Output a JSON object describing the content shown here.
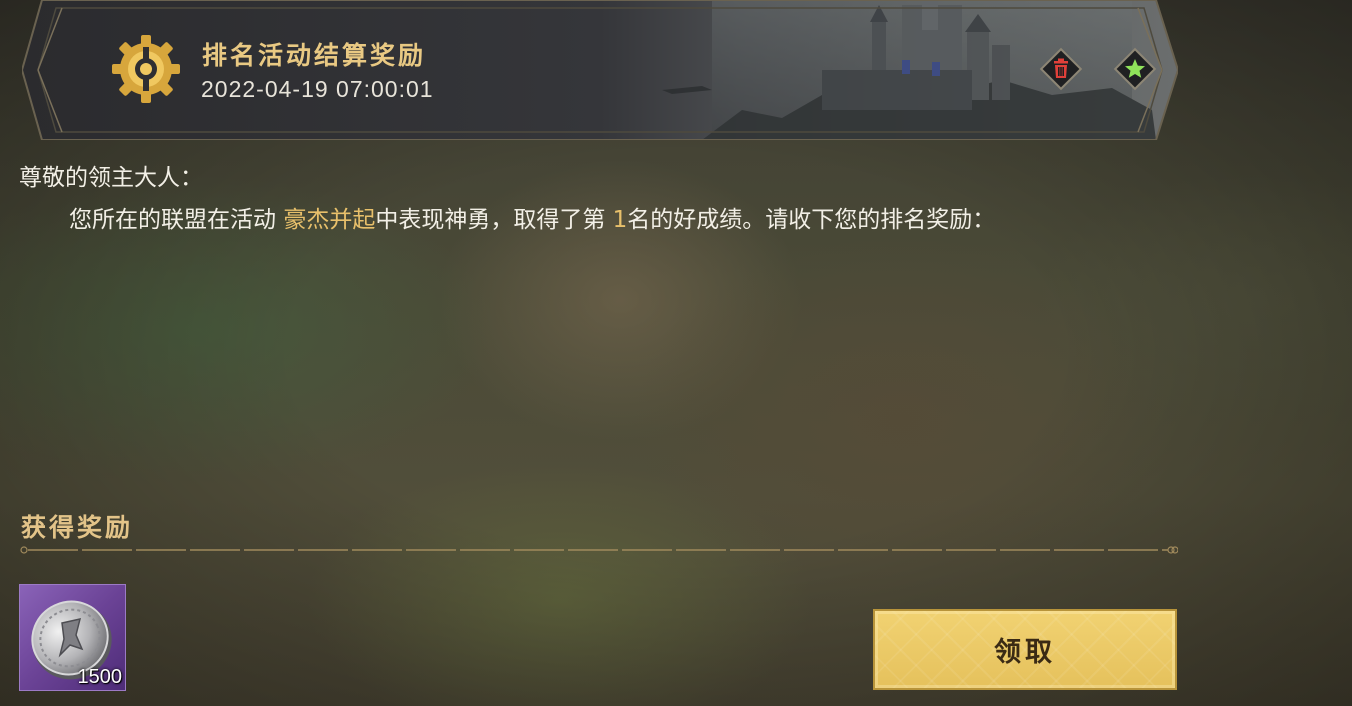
{
  "header": {
    "title": "排名活动结算奖励",
    "timestamp": "2022-04-19 07:00:01",
    "icon": "gear-icon",
    "actions": [
      {
        "name": "delete",
        "icon": "trash-icon",
        "color": "#e0403a"
      },
      {
        "name": "favorite",
        "icon": "star-icon",
        "color": "#8fe35a"
      }
    ]
  },
  "message": {
    "greeting": "尊敬的领主大人：",
    "part1": "您所在的联盟在活动 ",
    "event_name": "豪杰并起",
    "part2": "中表现神勇，取得了第 ",
    "rank": "1",
    "part3": "名的好成绩。请收下您的排名奖励："
  },
  "rewards": {
    "title": "获得奖励",
    "items": [
      {
        "icon": "silver-coin-icon",
        "count": "1500"
      }
    ]
  },
  "claim_button": {
    "label": "领取"
  },
  "colors": {
    "accent_gold": "#e8c06b",
    "button_gold": "#e5c15c",
    "item_purple": "#6b4396"
  }
}
